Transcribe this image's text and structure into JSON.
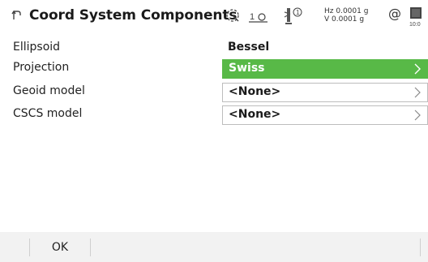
{
  "header": {
    "title": "Coord System Components",
    "status": {
      "level_number": "1",
      "prism_number": "1",
      "hz_text": "Hz 0.0001 g",
      "v_text": "V  0.0001 g",
      "at_symbol": "@",
      "battery_time": "10:0"
    },
    "icons": [
      "back-icon",
      "target-tracking-icon",
      "level-icon",
      "prism-icon",
      "at-icon",
      "battery-icon"
    ]
  },
  "form": {
    "ellipsoid": {
      "label": "Ellipsoid",
      "value": "Bessel"
    },
    "projection": {
      "label": "Projection",
      "value": "Swiss"
    },
    "geoid_model": {
      "label": "Geoid model",
      "value": "<None>"
    },
    "cscs_model": {
      "label": "CSCS model",
      "value": "<None>"
    }
  },
  "footer": {
    "ok_label": "OK"
  },
  "colors": {
    "accent": "#58b947",
    "footer_bg": "#f2f2f2",
    "border": "#bdbdbd"
  }
}
